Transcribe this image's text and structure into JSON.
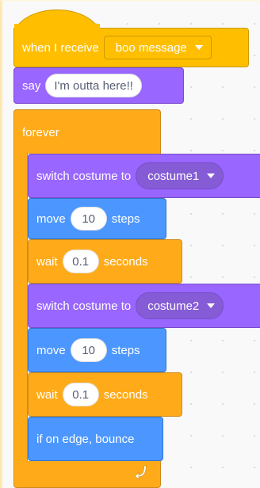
{
  "hat": {
    "label": "when I receive",
    "message": "boo message"
  },
  "say": {
    "label": "say",
    "text": "I'm outta here!!"
  },
  "forever": {
    "label": "forever"
  },
  "switch1": {
    "label": "switch costume to",
    "costume": "costume1"
  },
  "move1": {
    "label": "move",
    "steps": "10",
    "unit": "steps"
  },
  "wait1": {
    "label": "wait",
    "seconds": "0.1",
    "unit": "seconds"
  },
  "switch2": {
    "label": "switch costume to",
    "costume": "costume2"
  },
  "move2": {
    "label": "move",
    "steps": "10",
    "unit": "steps"
  },
  "wait2": {
    "label": "wait",
    "seconds": "0.1",
    "unit": "seconds"
  },
  "bounce": {
    "label": "if on edge, bounce"
  },
  "icons": {
    "loop": "loop-arrow-icon",
    "dropdown": "caret-down-icon"
  },
  "colors": {
    "events": "#ffbf00",
    "looks": "#9966ff",
    "motion": "#4c97ff",
    "control": "#ffab19"
  }
}
